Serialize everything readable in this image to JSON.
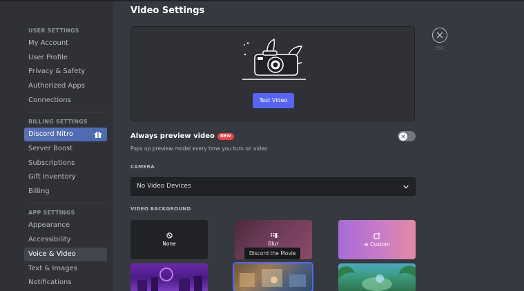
{
  "sidebar": {
    "user_settings": {
      "heading": "USER SETTINGS",
      "items": [
        "My Account",
        "User Profile",
        "Privacy & Safety",
        "Authorized Apps",
        "Connections"
      ]
    },
    "billing_settings": {
      "heading": "BILLING SETTINGS",
      "items": [
        "Discord Nitro",
        "Server Boost",
        "Subscriptions",
        "Gift Inventory",
        "Billing"
      ]
    },
    "app_settings": {
      "heading": "APP SETTINGS",
      "items": [
        "Appearance",
        "Accessibility",
        "Voice & Video",
        "Text & Images",
        "Notifications"
      ]
    },
    "selected": "Voice & Video"
  },
  "main": {
    "title": "Video Settings",
    "test_video_label": "Test Video",
    "close_label": "ESC",
    "always_preview": {
      "title": "Always preview video",
      "badge": "NEW",
      "description": "Pops up preview modal every time you turn on video",
      "enabled": false
    },
    "camera": {
      "label": "CAMERA",
      "selected": "No Video Devices"
    },
    "video_background": {
      "label": "VIDEO BACKGROUND",
      "tiles": [
        "None",
        "Blur",
        "Custom"
      ],
      "tooltip": "Discord the Movie"
    }
  },
  "colors": {
    "accent": "#5865f2",
    "badge_red": "#ed4245",
    "sidebar_bg": "#2f3136",
    "content_bg": "#36393f"
  }
}
